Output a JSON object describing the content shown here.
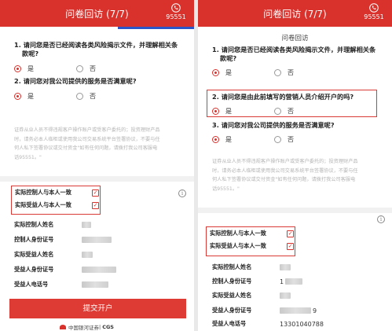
{
  "colors": {
    "brand_red": "#d9312c",
    "tab_blue": "#2d55c7"
  },
  "left": {
    "title": "问卷回访 (7/7)",
    "phone_icon": "phone-icon",
    "phone_number": "95551",
    "questions": [
      {
        "text_line1": "1. 请问您是否已经阅读各类风险揭示文件，并理解相关条",
        "text_line2": "款呢?",
        "yes": "是",
        "no": "否"
      },
      {
        "text_line1": "2. 请问您对我公司提供的服务是否满意呢?",
        "yes": "是",
        "no": "否"
      }
    ],
    "notice": [
      "证券从业人员不得违规客户操作账户或受客户委托的；投资理财产品",
      "时，请务必本人临柜或使用我公司交易系统平台签署协议，不要与任",
      "何人私下签署协议或交付资金\"如有任何问题，请拨打我公司客服电",
      "话95551。\""
    ],
    "checks": [
      {
        "label": "实际控制人与本人一致",
        "mark": "✓"
      },
      {
        "label": "实际受益人与本人一致",
        "mark": "✓"
      }
    ],
    "fields": [
      {
        "label": "实际控制人姓名"
      },
      {
        "label": "控制人身份证号"
      },
      {
        "label": "实际受益人姓名"
      },
      {
        "label": "受益人身份证号"
      },
      {
        "label": "受益人电话号"
      }
    ],
    "submit_label": "提交开户",
    "footer_brand": "中国银河证券",
    "footer_sep": "|",
    "footer_cgs": "CGS"
  },
  "right": {
    "title": "问卷回访 (7/7)",
    "phone_icon": "phone-icon",
    "phone_number": "95551",
    "heading": "问卷回访",
    "questions": [
      {
        "text_line1": "1. 请问您是否已经阅读各类风险揭示文件，并理解相关条",
        "text_line2": "款呢?",
        "yes": "是",
        "no": "否"
      },
      {
        "text_line1": "2. 请问您是由此前填写的营销人员介绍开户的吗?",
        "yes": "是",
        "no": "否"
      },
      {
        "text_line1": "3. 请问您对我公司提供的服务是否满意呢?",
        "yes": "是",
        "no": "否"
      }
    ],
    "notice": [
      "证券从业人员不得违规客户操作账户或受客户委托的；投资理财产品",
      "时，请务必本人临柜或使用我公司交易系统平台签署协议，不要与任",
      "何人私下签署协议或交付资金\"如有任何问题，请拨打我公司客服电",
      "话95551。\""
    ],
    "checks": [
      {
        "label": "实际控制人与本人一致",
        "mark": "✓"
      },
      {
        "label": "实际受益人与本人一致",
        "mark": "✓"
      }
    ],
    "fields": [
      {
        "label": "实际控制人姓名",
        "value": ""
      },
      {
        "label": "控制人身份证号",
        "value": "1"
      },
      {
        "label": "实际受益人姓名",
        "value": ""
      },
      {
        "label": "受益人身份证号",
        "value": "9"
      },
      {
        "label": "受益人电话号",
        "value": "13301040788"
      }
    ]
  }
}
